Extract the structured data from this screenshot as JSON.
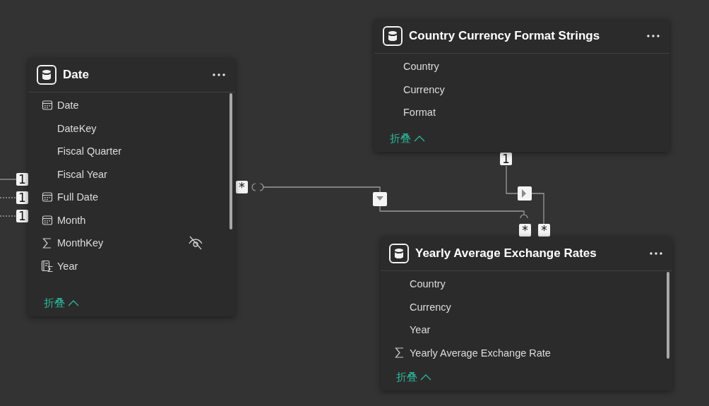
{
  "tables": [
    {
      "name": "Date",
      "collapse_label": "折叠",
      "fields": [
        {
          "name": "Date",
          "kind": "date",
          "hidden": false
        },
        {
          "name": "DateKey",
          "kind": "plain",
          "hidden": false
        },
        {
          "name": "Fiscal Quarter",
          "kind": "plain",
          "hidden": false
        },
        {
          "name": "Fiscal Year",
          "kind": "plain",
          "hidden": false
        },
        {
          "name": "Full Date",
          "kind": "date",
          "hidden": false
        },
        {
          "name": "Month",
          "kind": "date",
          "hidden": false
        },
        {
          "name": "MonthKey",
          "kind": "measure",
          "hidden": true
        },
        {
          "name": "Year",
          "kind": "hierarchy",
          "hidden": false
        }
      ]
    },
    {
      "name": "Country Currency Format Strings",
      "collapse_label": "折叠",
      "fields": [
        {
          "name": "Country",
          "kind": "plain",
          "hidden": false
        },
        {
          "name": "Currency",
          "kind": "plain",
          "hidden": false
        },
        {
          "name": "Format",
          "kind": "plain",
          "hidden": false
        }
      ]
    },
    {
      "name": "Yearly Average Exchange Rates",
      "collapse_label": "折叠",
      "fields": [
        {
          "name": "Country",
          "kind": "plain",
          "hidden": false
        },
        {
          "name": "Currency",
          "kind": "plain",
          "hidden": false
        },
        {
          "name": "Year",
          "kind": "plain",
          "hidden": false
        },
        {
          "name": "Yearly Average Exchange Rate",
          "kind": "measure",
          "hidden": false
        }
      ]
    }
  ],
  "relationships": [
    {
      "end_label": "1"
    },
    {
      "end_label": "1"
    },
    {
      "end_label": "1"
    },
    {
      "from_label": "*",
      "to_label": "*"
    },
    {
      "from_label": "1",
      "to_label": "*"
    }
  ]
}
